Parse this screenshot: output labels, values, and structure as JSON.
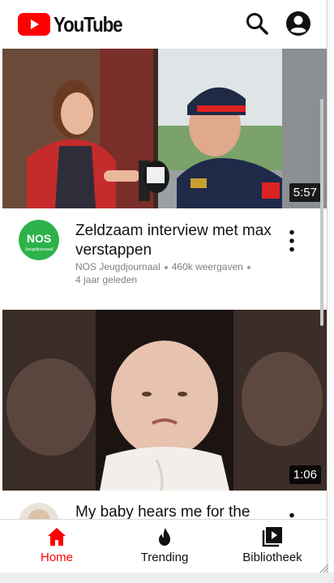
{
  "header": {
    "logo_text": "YouTube",
    "brand_color": "#ff0000",
    "search_icon": "search-icon",
    "account_icon": "account-circle-icon"
  },
  "videos": [
    {
      "duration": "5:57",
      "title": "Zeldzaam interview met max verstappen",
      "channel": "NOS Jeugdjournaal",
      "views": "460k weergaven",
      "age": "4 jaar geleden",
      "avatar_text": "NOS",
      "avatar_subtext": "Jeugdjournaal",
      "avatar_color": "#2db24a"
    },
    {
      "duration": "1:06",
      "title": "My baby hears me for the",
      "channel": "",
      "views": "",
      "age": ""
    }
  ],
  "nav": {
    "items": [
      {
        "label": "Home",
        "icon": "home-icon",
        "active": true
      },
      {
        "label": "Trending",
        "icon": "flame-icon",
        "active": false
      },
      {
        "label": "Bibliotheek",
        "icon": "library-icon",
        "active": false
      }
    ],
    "active_color": "#ff0000"
  }
}
